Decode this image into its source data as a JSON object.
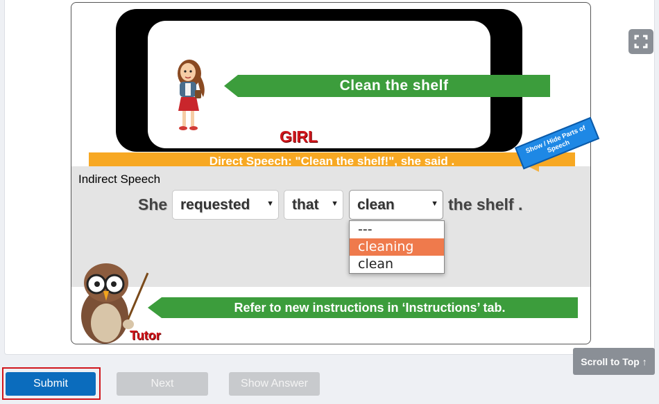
{
  "scene": {
    "command": "Clean the shelf",
    "speaker_label": "GIRL",
    "direct_speech": "Direct Speech:   \"Clean  the shelf!\", she said .",
    "parts_of_speech_tab": "Show / Hide Parts of Speech"
  },
  "exercise": {
    "section_label": "Indirect Speech",
    "subject": "She",
    "blank1": "requested",
    "blank2": "that",
    "blank3": "clean",
    "ending": "the shelf .",
    "dropdown_options": [
      "---",
      "cleaning",
      "clean"
    ],
    "highlighted_option": "cleaning"
  },
  "tutor": {
    "message": "Refer to new instructions in ‘Instructions’ tab.",
    "label": "Tutor"
  },
  "controls": {
    "scroll_top": "Scroll to Top ↑",
    "submit": "Submit",
    "next": "Next",
    "show_answer": "Show Answer"
  },
  "icons": {
    "expand": "expand-icon"
  },
  "colors": {
    "green": "#3c9d3c",
    "orange": "#f7a823",
    "red": "#d0151b",
    "blue": "#0b6cbd",
    "highlight": "#ef7a4c"
  }
}
